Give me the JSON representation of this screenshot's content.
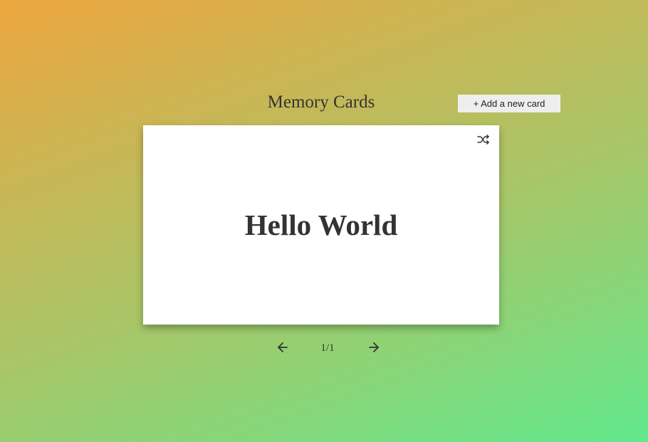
{
  "header": {
    "title": "Memory Cards",
    "add_button_label": "+ Add a new card"
  },
  "card": {
    "front_text": "Hello World",
    "shuffle_icon": "shuffle-icon"
  },
  "navigation": {
    "prev_icon": "arrow-left-icon",
    "next_icon": "arrow-right-icon",
    "counter": "1/1"
  },
  "colors": {
    "gradient_start": "#eda63f",
    "gradient_end": "#62e88c",
    "card_background": "#ffffff",
    "text": "#333333",
    "button_background": "#eeeeee"
  }
}
